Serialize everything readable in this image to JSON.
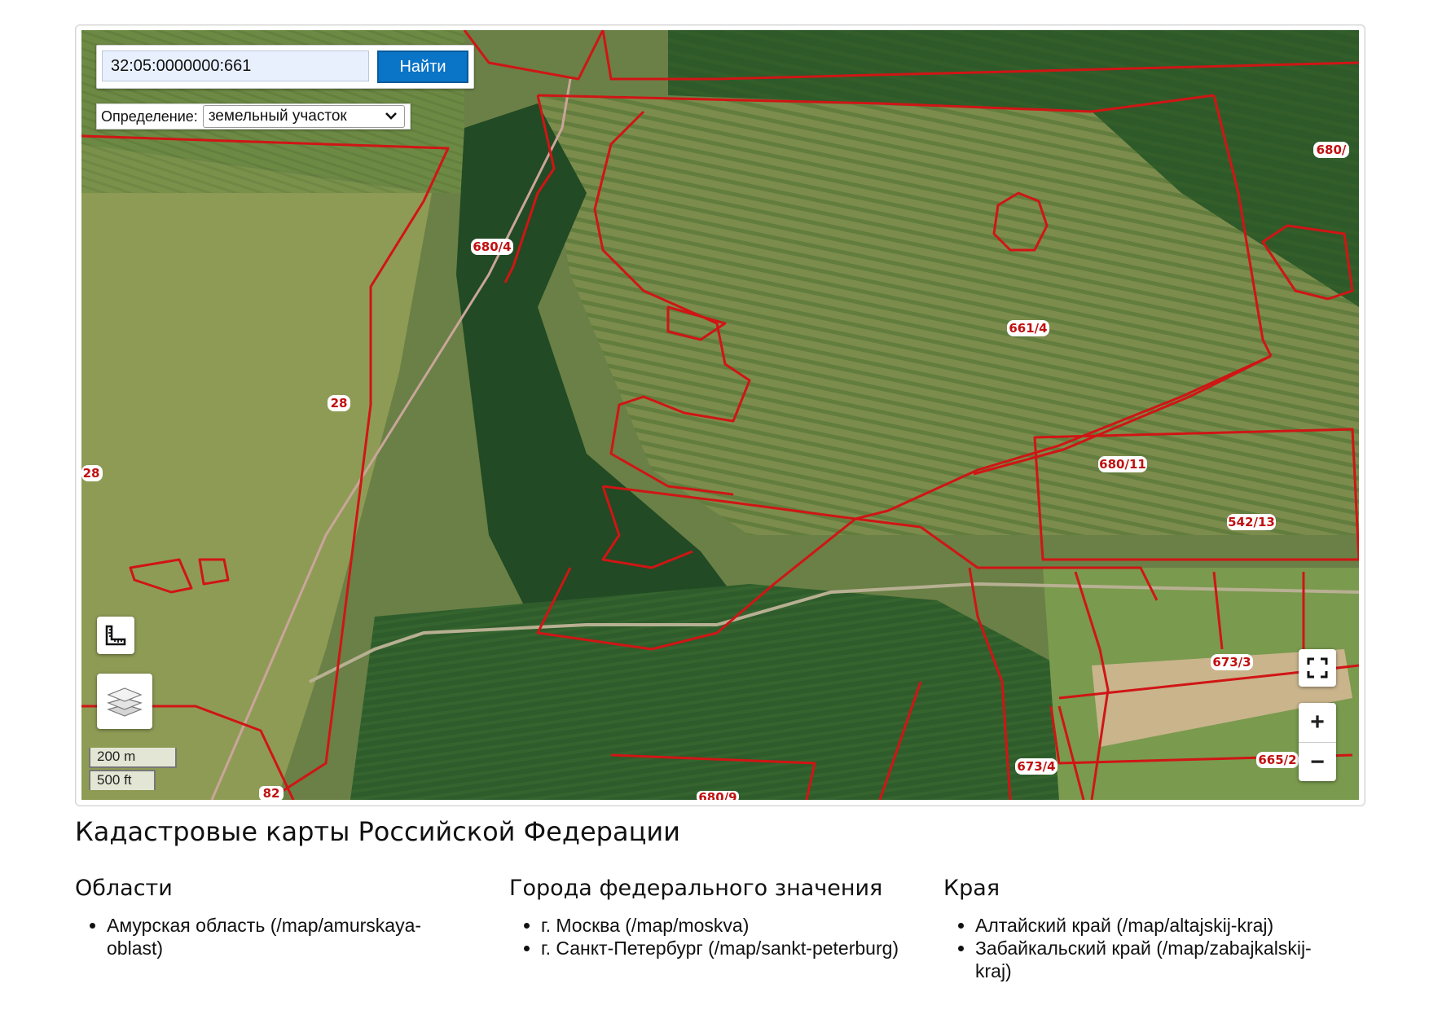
{
  "search": {
    "value": "32:05:0000000:661",
    "button_label": "Найти"
  },
  "definition": {
    "label": "Определение:",
    "selected": "земельный участок"
  },
  "map": {
    "parcel_labels": [
      "680/",
      "680/4",
      "661/4",
      "28",
      "28",
      "680/11",
      "542/13",
      "673/3",
      "673/4",
      "665/2",
      "680/9",
      "82"
    ],
    "scale": {
      "metric": "200 m",
      "imperial": "500 ft"
    },
    "boundary_color": "#d01515",
    "icons": [
      "ruler-icon",
      "layers-icon",
      "fullscreen-icon",
      "zoom-in-icon",
      "zoom-out-icon"
    ],
    "zoom_in_label": "+",
    "zoom_out_label": "−"
  },
  "page": {
    "title": "Кадастровые карты Российской Федерации"
  },
  "sections": [
    {
      "heading": "Области",
      "items": [
        "Амурская область (/map/amurskaya-oblast)"
      ]
    },
    {
      "heading": "Города федерального значения",
      "items": [
        "г. Москва (/map/moskva)",
        "г. Санкт-Петербург (/map/sankt-peterburg)"
      ]
    },
    {
      "heading": "Края",
      "items": [
        "Алтайский край (/map/altajskij-kraj)",
        "Забайкальский край (/map/zabajkalskij-kraj)"
      ]
    }
  ]
}
